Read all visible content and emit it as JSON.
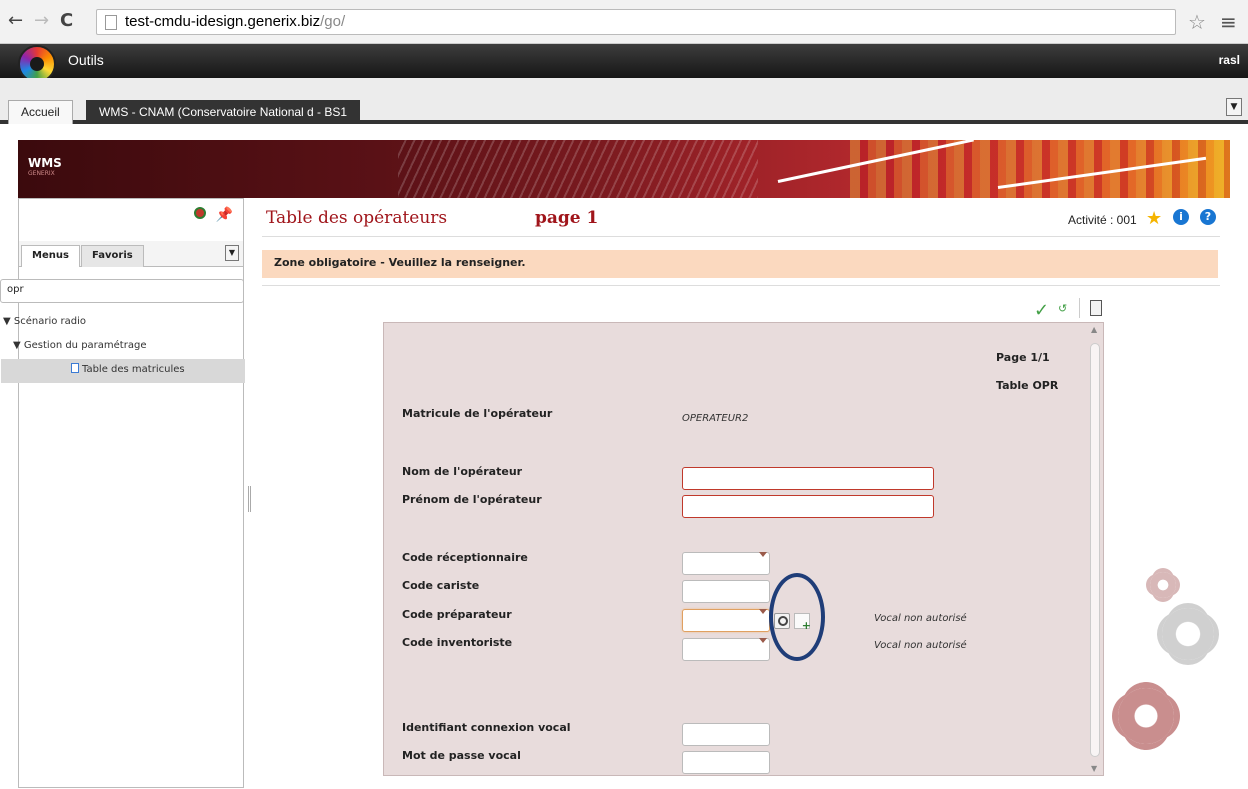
{
  "browser": {
    "url_host": "test-cmdu-idesign.generix.biz",
    "url_path": "/go/"
  },
  "app_bar": {
    "title": "Outils",
    "user": "rasl"
  },
  "tabs": {
    "home_label": "Accueil",
    "active_label": "WMS - CNAM (Conservatoire National d - BS1"
  },
  "banner": {
    "title": "WMS",
    "subtitle": "GENERIX"
  },
  "left_panel": {
    "tabs": [
      "Menus",
      "Favoris"
    ],
    "search_value": "opr",
    "tree": [
      {
        "label": "Scénario radio",
        "expander": "▼"
      },
      {
        "label": "Gestion du paramétrage",
        "expander": "▼"
      },
      {
        "label": "Table des matricules"
      }
    ]
  },
  "header": {
    "title": "Table des opérateurs",
    "page": "page 1",
    "activity": "Activité : 001"
  },
  "alert": {
    "message": "Zone obligatoire - Veuillez la renseigner."
  },
  "form": {
    "page_info": "Page 1/1",
    "table_info": "Table OPR",
    "fields": {
      "matricule_label": "Matricule de l'opérateur",
      "matricule_value": "OPERATEUR2",
      "nom_label": "Nom de l'opérateur",
      "prenom_label": "Prénom de l'opérateur",
      "receptionnaire_label": "Code réceptionnaire",
      "cariste_label": "Code cariste",
      "preparateur_label": "Code préparateur",
      "preparateur_note": "Vocal non autorisé",
      "inventoriste_label": "Code inventoriste",
      "inventoriste_note": "Vocal non autorisé",
      "id_vocal_label": "Identifiant connexion vocal",
      "mdp_vocal_label": "Mot de passe vocal"
    }
  },
  "colors": {
    "title_red": "#a0151b",
    "alert_bg": "#fbd9bf",
    "form_bg": "#e8dcdc",
    "annotation_circle": "#1f3d78"
  }
}
